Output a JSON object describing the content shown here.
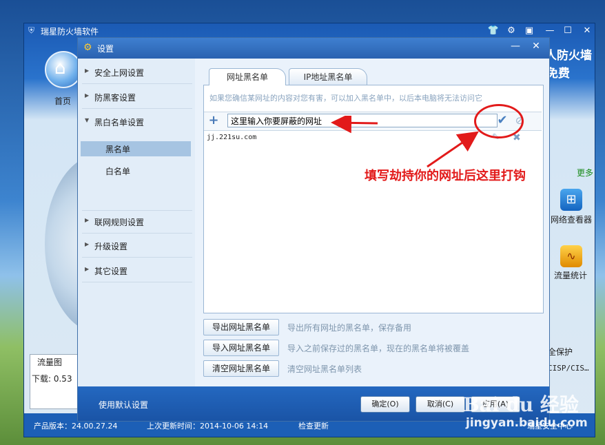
{
  "app": {
    "title": "瑞星防火墙软件",
    "brand_line1": "人防火墙",
    "brand_line2": "免费",
    "home_label": "首页",
    "more_label": "更多",
    "net_viewer_label": "网络查看器",
    "flow_stats_label": "流量统计",
    "protect_label": "全保护",
    "cisp_label": "CISP/CIS…",
    "traffic_title": "流量图",
    "traffic_value": "下载: 0.53",
    "status": {
      "version": "产品版本：24.00.27.24",
      "updated": "上次更新时间：2014-10-06 14:14",
      "check_update": "检查更新",
      "security_center": "瑞星安全中心"
    }
  },
  "dialog": {
    "title": "设置",
    "sidebar": {
      "items": [
        {
          "label": "安全上网设置"
        },
        {
          "label": "防黑客设置"
        },
        {
          "label": "黑白名单设置"
        },
        {
          "label": "联网规则设置"
        },
        {
          "label": "升级设置"
        },
        {
          "label": "其它设置"
        }
      ],
      "subitems": [
        {
          "label": "黑名单"
        },
        {
          "label": "白名单"
        }
      ]
    },
    "tabs": [
      {
        "label": "网址黑名单"
      },
      {
        "label": "IP地址黑名单"
      }
    ],
    "hint": "如果您确信某网址的内容对您有害，可以加入黑名单中，以后本电脑将无法访问它",
    "input": {
      "value": "这里输入你要屏蔽的网址"
    },
    "list": [
      {
        "url": "jj.221su.com"
      }
    ],
    "actions": [
      {
        "label": "导出网址黑名单",
        "desc": "导出所有网址的黑名单，保存备用"
      },
      {
        "label": "导入网址黑名单",
        "desc": "导入之前保存过的黑名单，现在的黑名单将被覆盖"
      },
      {
        "label": "清空网址黑名单",
        "desc": "清空网址黑名单列表"
      }
    ],
    "footer": {
      "default_label": "使用默认设置",
      "ok_label": "确定(O)",
      "cancel_label": "取消(C)",
      "apply_label": "应用(A)"
    }
  },
  "annotation": {
    "text": "填写劫持你的网址后这里打钩",
    "color": "#e21a1a"
  },
  "watermark": {
    "line1": "Bai du 经验",
    "line2": "jingyan.baidu.com"
  }
}
